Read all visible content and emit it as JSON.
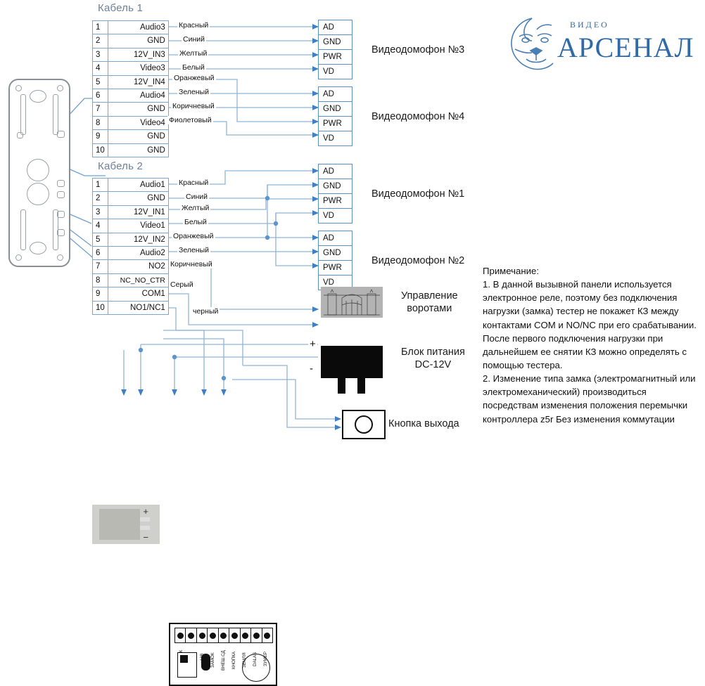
{
  "logo": {
    "brand": "АРСЕНАЛ",
    "sub": "ВИДЕО",
    "color": "#2f6aa8"
  },
  "cables": [
    {
      "title": "Кабель 1",
      "rows": [
        {
          "num": "1",
          "signal": "Audio3",
          "wire": "Красный"
        },
        {
          "num": "2",
          "signal": "GND",
          "wire": "Синий"
        },
        {
          "num": "3",
          "signal": "12V_IN3",
          "wire": "Желтый"
        },
        {
          "num": "4",
          "signal": "Video3",
          "wire": "Белый"
        },
        {
          "num": "5",
          "signal": "12V_IN4",
          "wire": "Оранжевый"
        },
        {
          "num": "6",
          "signal": "Audio4",
          "wire": "Зеленый"
        },
        {
          "num": "7",
          "signal": "GND",
          "wire": "Коричневый"
        },
        {
          "num": "8",
          "signal": "Video4",
          "wire": "Фиолетовый"
        },
        {
          "num": "9",
          "signal": "GND",
          "wire": ""
        },
        {
          "num": "10",
          "signal": "GND",
          "wire": ""
        }
      ]
    },
    {
      "title": "Кабель 2",
      "rows": [
        {
          "num": "1",
          "signal": "Audio1",
          "wire": "Красный"
        },
        {
          "num": "2",
          "signal": "GND",
          "wire": "Синий"
        },
        {
          "num": "3",
          "signal": "12V_IN1",
          "wire": "Желтый"
        },
        {
          "num": "4",
          "signal": "Video1",
          "wire": "Белый"
        },
        {
          "num": "5",
          "signal": "12V_IN2",
          "wire": "Оранжевый"
        },
        {
          "num": "6",
          "signal": "Audio2",
          "wire": "Зеленый"
        },
        {
          "num": "7",
          "signal": "NO2",
          "wire": "Коричневый"
        },
        {
          "num": "8",
          "signal": "NC_NO_CTR",
          "wire": ""
        },
        {
          "num": "9",
          "signal": "COM1",
          "wire": "Серый"
        },
        {
          "num": "10",
          "signal": "NO1/NC1",
          "wire": "черный"
        }
      ]
    }
  ],
  "terminals": [
    {
      "label": "Видеодомофон №3",
      "pins": [
        "AD",
        "GND",
        "PWR",
        "VD"
      ]
    },
    {
      "label": "Видеодомофон №4",
      "pins": [
        "AD",
        "GND",
        "PWR",
        "VD"
      ]
    },
    {
      "label": "Видеодомофон №1",
      "pins": [
        "AD",
        "GND",
        "PWR",
        "VD"
      ]
    },
    {
      "label": "Видеодомофон №2",
      "pins": [
        "AD",
        "GND",
        "PWR",
        "VD"
      ]
    }
  ],
  "devices": {
    "gate": {
      "label_line1": "Управление",
      "label_line2": "воротами"
    },
    "psu": {
      "label_line1": "Блок питания",
      "label_line2": "DC-12V",
      "plus": "+",
      "minus": "-"
    },
    "exit_button": {
      "label": "Кнопка выхода"
    },
    "lock": {
      "plus": "+",
      "minus": "−"
    }
  },
  "controller": {
    "terminals": [
      "ЗВОНОК",
      "ЗЕМЛЯ",
      "+12В",
      "ЗАМОК",
      "ВНЕШ.СД",
      "КНОПКА",
      "ЗЕМЛЯ",
      "DALAS",
      "ЗУМЕР"
    ]
  },
  "note": {
    "title": "Примечание:",
    "item1": "1. В данной вызывной панели используется электронное реле, поэтому без подключения нагрузки (замка) тестер не покажет КЗ между контактами COM и NO/NC при его срабатывании. После первого подключения нагрузки при дальнейшем ее снятии КЗ можно определять с помощью тестера.",
    "item2": "2. Изменение типа замка (электромагнитный или электромеханический) производиться посредствам изменения положения перемычки контроллера z5r Без изменения коммутации"
  },
  "colors": {
    "wire": "#8fb4dc",
    "table_border": "#7aa6d2",
    "title": "#6f8196",
    "accent": "#2f6aa8"
  }
}
